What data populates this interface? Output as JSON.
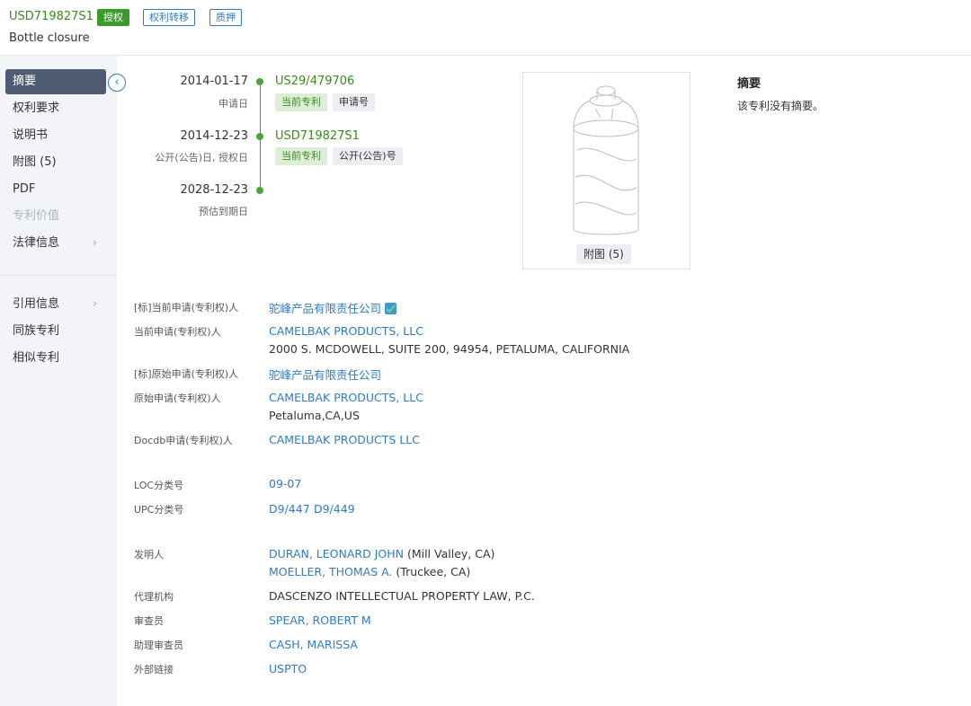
{
  "header": {
    "patent_number": "USD719827S1",
    "tags": {
      "granted": "授权",
      "transfer": "权利转移",
      "pledge": "质押"
    },
    "title": "Bottle closure"
  },
  "sidebar": {
    "items": [
      {
        "label": "摘要",
        "state": "active"
      },
      {
        "label": "权利要求"
      },
      {
        "label": "说明书"
      },
      {
        "label": "附图 (5)"
      },
      {
        "label": "PDF"
      },
      {
        "label": "专利价值",
        "state": "disabled"
      },
      {
        "label": "法律信息",
        "chevron": "chevron-right-icon"
      },
      {
        "label": "引用信息",
        "chevron": "chevron-right-icon"
      },
      {
        "label": "同族专利"
      },
      {
        "label": "相似专利"
      }
    ],
    "collapse_icon": "chevron-left-icon"
  },
  "timeline": [
    {
      "date": "2014-01-17",
      "label": "申请日",
      "number": "US29/479706",
      "pills": [
        "当前专利",
        "申请号"
      ]
    },
    {
      "date": "2014-12-23",
      "label": "公开(公告)日, 授权日",
      "number": "USD719827S1",
      "pills": [
        "当前专利",
        "公开(公告)号"
      ]
    },
    {
      "date": "2028-12-23",
      "label": "预估到期日"
    }
  ],
  "figure": {
    "button_label": "附图 (5)"
  },
  "abstract": {
    "title": "摘要",
    "text": "该专利没有摘要。"
  },
  "fields": {
    "std_current_applicant": {
      "label": "[标]当前申请(专利权)人",
      "value": "驼峰产品有限责任公司"
    },
    "current_applicant": {
      "label": "当前申请(专利权)人",
      "value": "CAMELBAK PRODUCTS, LLC",
      "address": "2000 S. MCDOWELL, SUITE 200, 94954, PETALUMA, CALIFORNIA"
    },
    "std_original_applicant": {
      "label": "[标]原始申请(专利权)人",
      "value": "驼峰产品有限责任公司"
    },
    "original_applicant": {
      "label": "原始申请(专利权)人",
      "value": "CAMELBAK PRODUCTS, LLC",
      "address": "Petaluma,CA,US"
    },
    "docdb_applicant": {
      "label": "Docdb申请(专利权)人",
      "value": "CAMELBAK PRODUCTS LLC"
    },
    "loc": {
      "label": "LOC分类号",
      "value": "09-07"
    },
    "upc": {
      "label": "UPC分类号",
      "values": [
        "D9/447",
        "D9/449"
      ]
    },
    "inventors": {
      "label": "发明人",
      "items": [
        {
          "name": "DURAN, LEONARD JOHN",
          "location": "(Mill Valley, CA)"
        },
        {
          "name": "MOELLER, THOMAS A.",
          "location": "(Truckee, CA)"
        }
      ]
    },
    "agency": {
      "label": "代理机构",
      "value": "DASCENZO INTELLECTUAL PROPERTY LAW, P.C."
    },
    "examiner": {
      "label": "审查员",
      "value": "SPEAR, ROBERT M"
    },
    "assistant_examiner": {
      "label": "助理审查员",
      "value": "CASH, MARISSA"
    },
    "external_link": {
      "label": "外部链接",
      "value": "USPTO"
    }
  },
  "colors": {
    "accent_green": "#3b8a1e",
    "link_blue": "#2f7bc4",
    "nav_active": "#4f5c73"
  }
}
